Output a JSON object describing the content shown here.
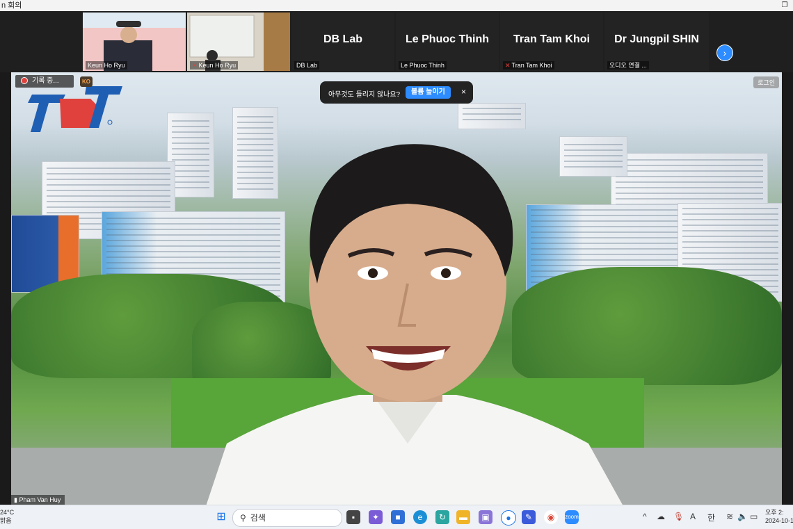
{
  "window": {
    "title": "n 회의"
  },
  "strip": {
    "tiles": [
      {
        "small_name": "Keun Ho Ryu"
      },
      {
        "small_name": "Keun Ho Ryu"
      },
      {
        "big_name": "DB Lab",
        "small_name": "DB Lab"
      },
      {
        "big_name": "Le Phuoc Thinh",
        "small_name": "Le Phuoc Thinh"
      },
      {
        "big_name": "Tran Tam Khoi",
        "small_name": "Tran Tam Khoi"
      },
      {
        "big_name": "Dr Jungpil SHIN",
        "small_name": "오디오 연결 ..."
      }
    ]
  },
  "stage": {
    "recording_label": "기록 중...",
    "language_badge": "KO",
    "toast_message": "아무것도 들리지 않나요?",
    "toast_button": "볼륨 높이기",
    "login_label": "로그인",
    "speaker_name": "Pham Van Huy"
  },
  "taskbar": {
    "weather_temp": "24°C",
    "weather_cond": "맑음",
    "search_label": "검색",
    "ime_a": "A",
    "ime_han": "한",
    "clock_time": "오후 2:",
    "clock_date": "2024-10-1"
  },
  "colors": {
    "accent": "#2d8cff",
    "muted_red": "#e0413c"
  }
}
